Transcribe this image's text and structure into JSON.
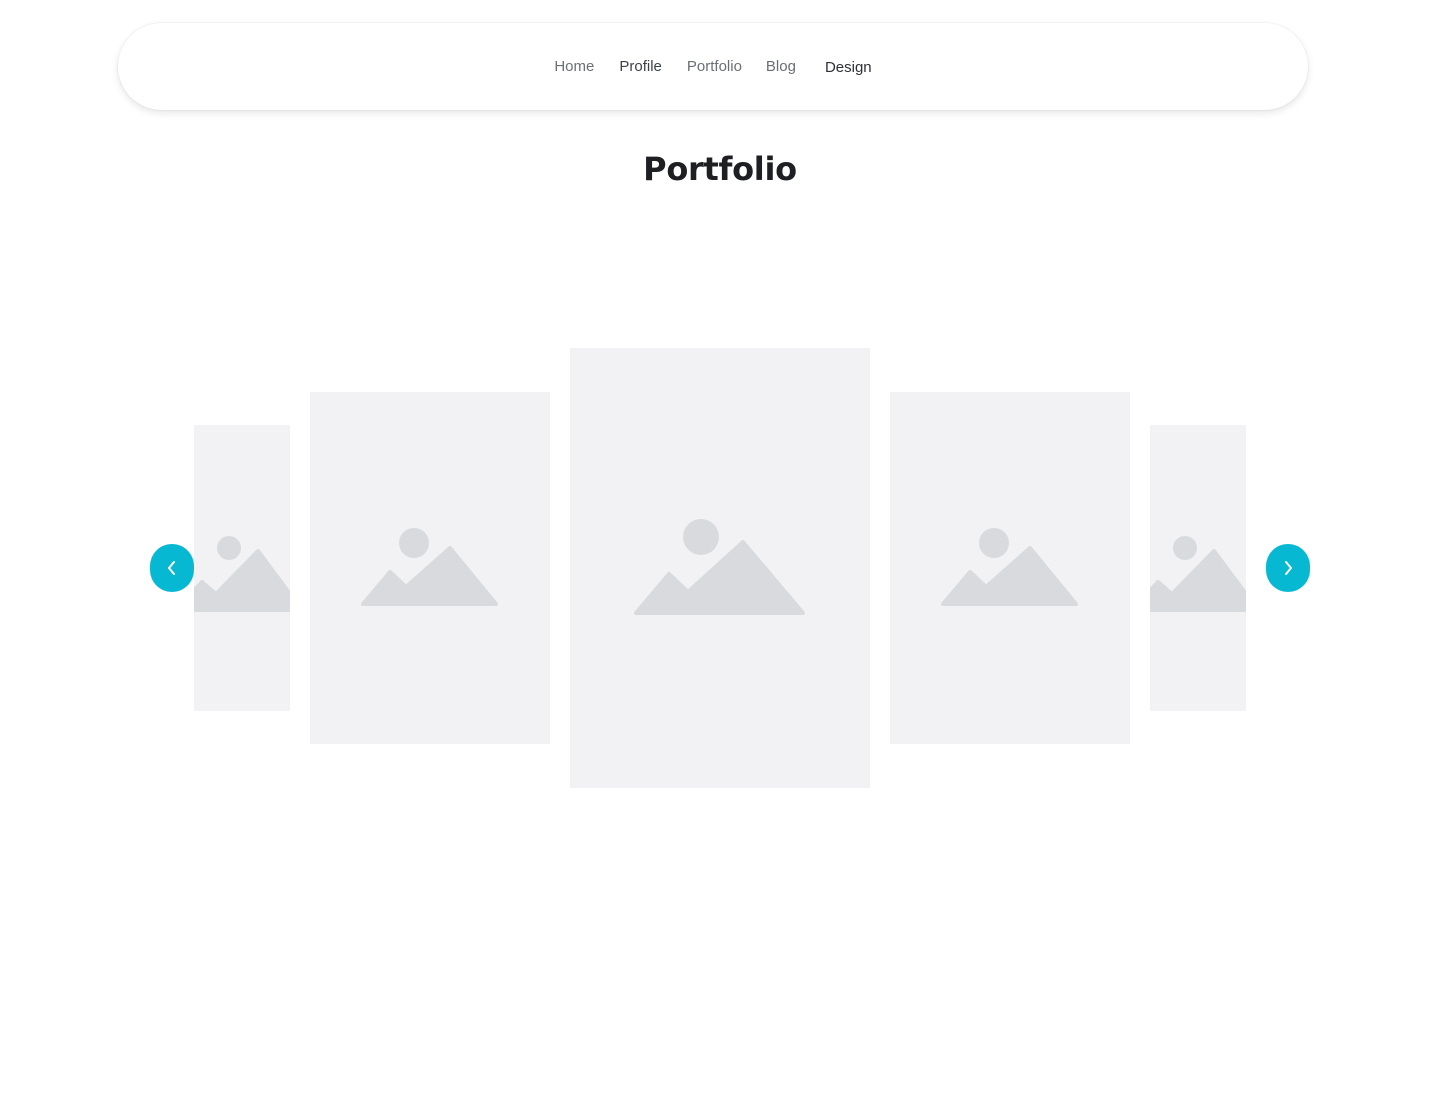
{
  "nav": {
    "items": [
      {
        "label": "Home"
      },
      {
        "label": "Profile"
      },
      {
        "label": "Portfolio"
      },
      {
        "label": "Blog"
      },
      {
        "label": "Design"
      }
    ]
  },
  "page": {
    "title": "Portfolio"
  },
  "carousel": {
    "slides": [
      {
        "icon": "image-placeholder-icon"
      },
      {
        "icon": "image-placeholder-icon"
      },
      {
        "icon": "image-placeholder-icon"
      },
      {
        "icon": "image-placeholder-icon"
      },
      {
        "icon": "image-placeholder-icon"
      }
    ],
    "prev_icon": "chevron-left-icon",
    "next_icon": "chevron-right-icon"
  },
  "colors": {
    "accent": "#07b8d2",
    "placeholder_bg": "#f2f2f4",
    "placeholder_icon": "#d9dadd",
    "title": "#1d1f23"
  }
}
